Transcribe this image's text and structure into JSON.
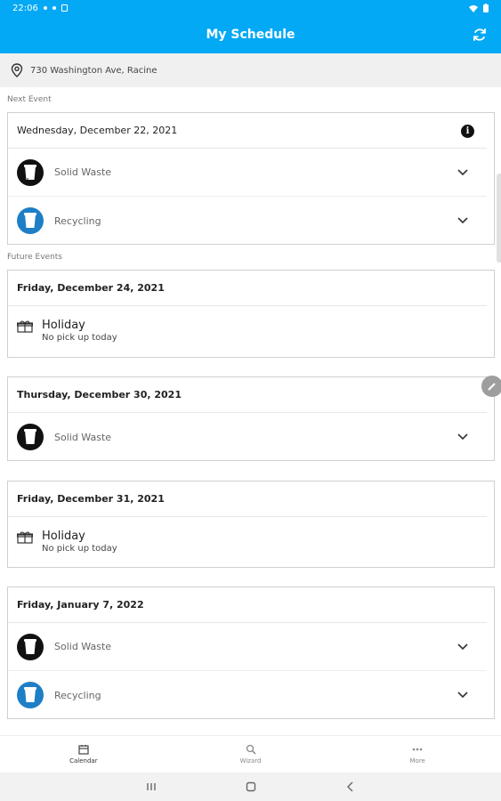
{
  "status_bar": {
    "time": "22:06"
  },
  "header": {
    "title": "My Schedule"
  },
  "address": {
    "text": "730 Washington Ave, Racine"
  },
  "sections": {
    "next_event": "Next Event",
    "future_events": "Future Events"
  },
  "next_event": {
    "date": "Wednesday, December 22, 2021",
    "items": [
      {
        "label": "Solid Waste",
        "type": "solid-waste"
      },
      {
        "label": "Recycling",
        "type": "recycling"
      }
    ]
  },
  "future_events": [
    {
      "date": "Friday, December 24, 2021",
      "holiday": {
        "title": "Holiday",
        "subtitle": "No pick up today"
      }
    },
    {
      "date": "Thursday, December 30, 2021",
      "items": [
        {
          "label": "Solid Waste"
        }
      ]
    },
    {
      "date": "Friday, December 31, 2021",
      "holiday": {
        "title": "Holiday",
        "subtitle": "No pick up today"
      }
    },
    {
      "date": "Friday, January 7, 2022",
      "items": [
        {
          "label": "Solid Waste"
        },
        {
          "label": "Recycling"
        }
      ]
    }
  ],
  "bottom_nav": [
    {
      "label": "Calendar",
      "icon": "calendar-icon"
    },
    {
      "label": "Wizard",
      "icon": "search-icon"
    },
    {
      "label": "More",
      "icon": "more-icon"
    }
  ],
  "colors": {
    "primary": "#03a9f4",
    "recycling": "#1e7fc6",
    "solid_waste": "#111111"
  }
}
